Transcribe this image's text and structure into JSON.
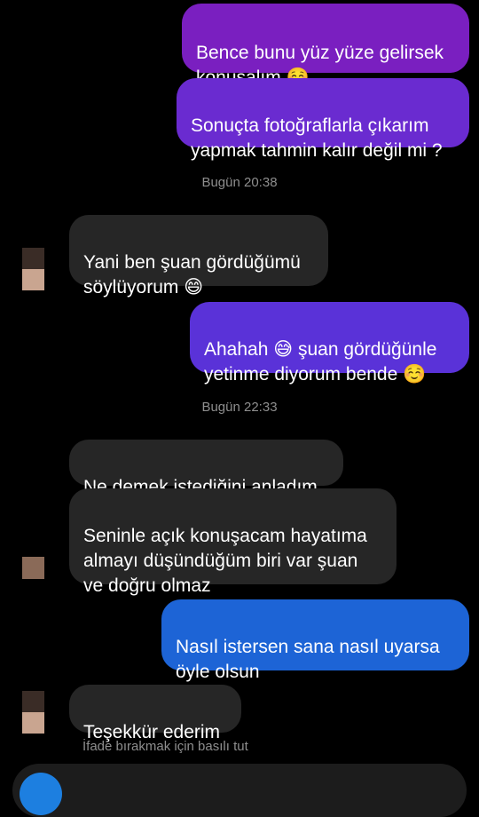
{
  "messages": [
    {
      "side": "out",
      "text": "Bence bunu yüz yüze gelirsek\nkonuşalım ☺️"
    },
    {
      "side": "out",
      "text": "Sonuçta fotoğraflarla çıkarım\nyapmak tahmin kalır değil mi ?"
    },
    {
      "timestamp": "Bugün 20:38"
    },
    {
      "side": "in",
      "text": "Yani ben şuan gördüğümü\nsöylüyorum 😄"
    },
    {
      "side": "out",
      "text": "Ahahah 😅 şuan gördüğünle\nyetinme diyorum bende ☺️"
    },
    {
      "timestamp": "Bugün 22:33"
    },
    {
      "side": "in",
      "text": "Ne demek istediğini anladım"
    },
    {
      "side": "in",
      "text": "Seninle açık konuşacam hayatıma\nalmayı düşündüğüm biri var şuan\nve doğru olmaz"
    },
    {
      "side": "out",
      "text": "Nasıl istersen sana nasıl uyarsa\nöyle olsun"
    },
    {
      "side": "in",
      "text": "Teşekkür ederim"
    }
  ],
  "reaction_hint": "İfade bırakmak için basılı tut",
  "colors": {
    "background": "#000000",
    "incoming_bubble": "#262626",
    "outgoing_gradient": [
      "#7a1fc0",
      "#6a2bd0",
      "#5a32d8",
      "#1d64d6"
    ],
    "timestamp_text": "#8e8e8e"
  },
  "icons": [
    "avatar",
    "camera-icon"
  ]
}
